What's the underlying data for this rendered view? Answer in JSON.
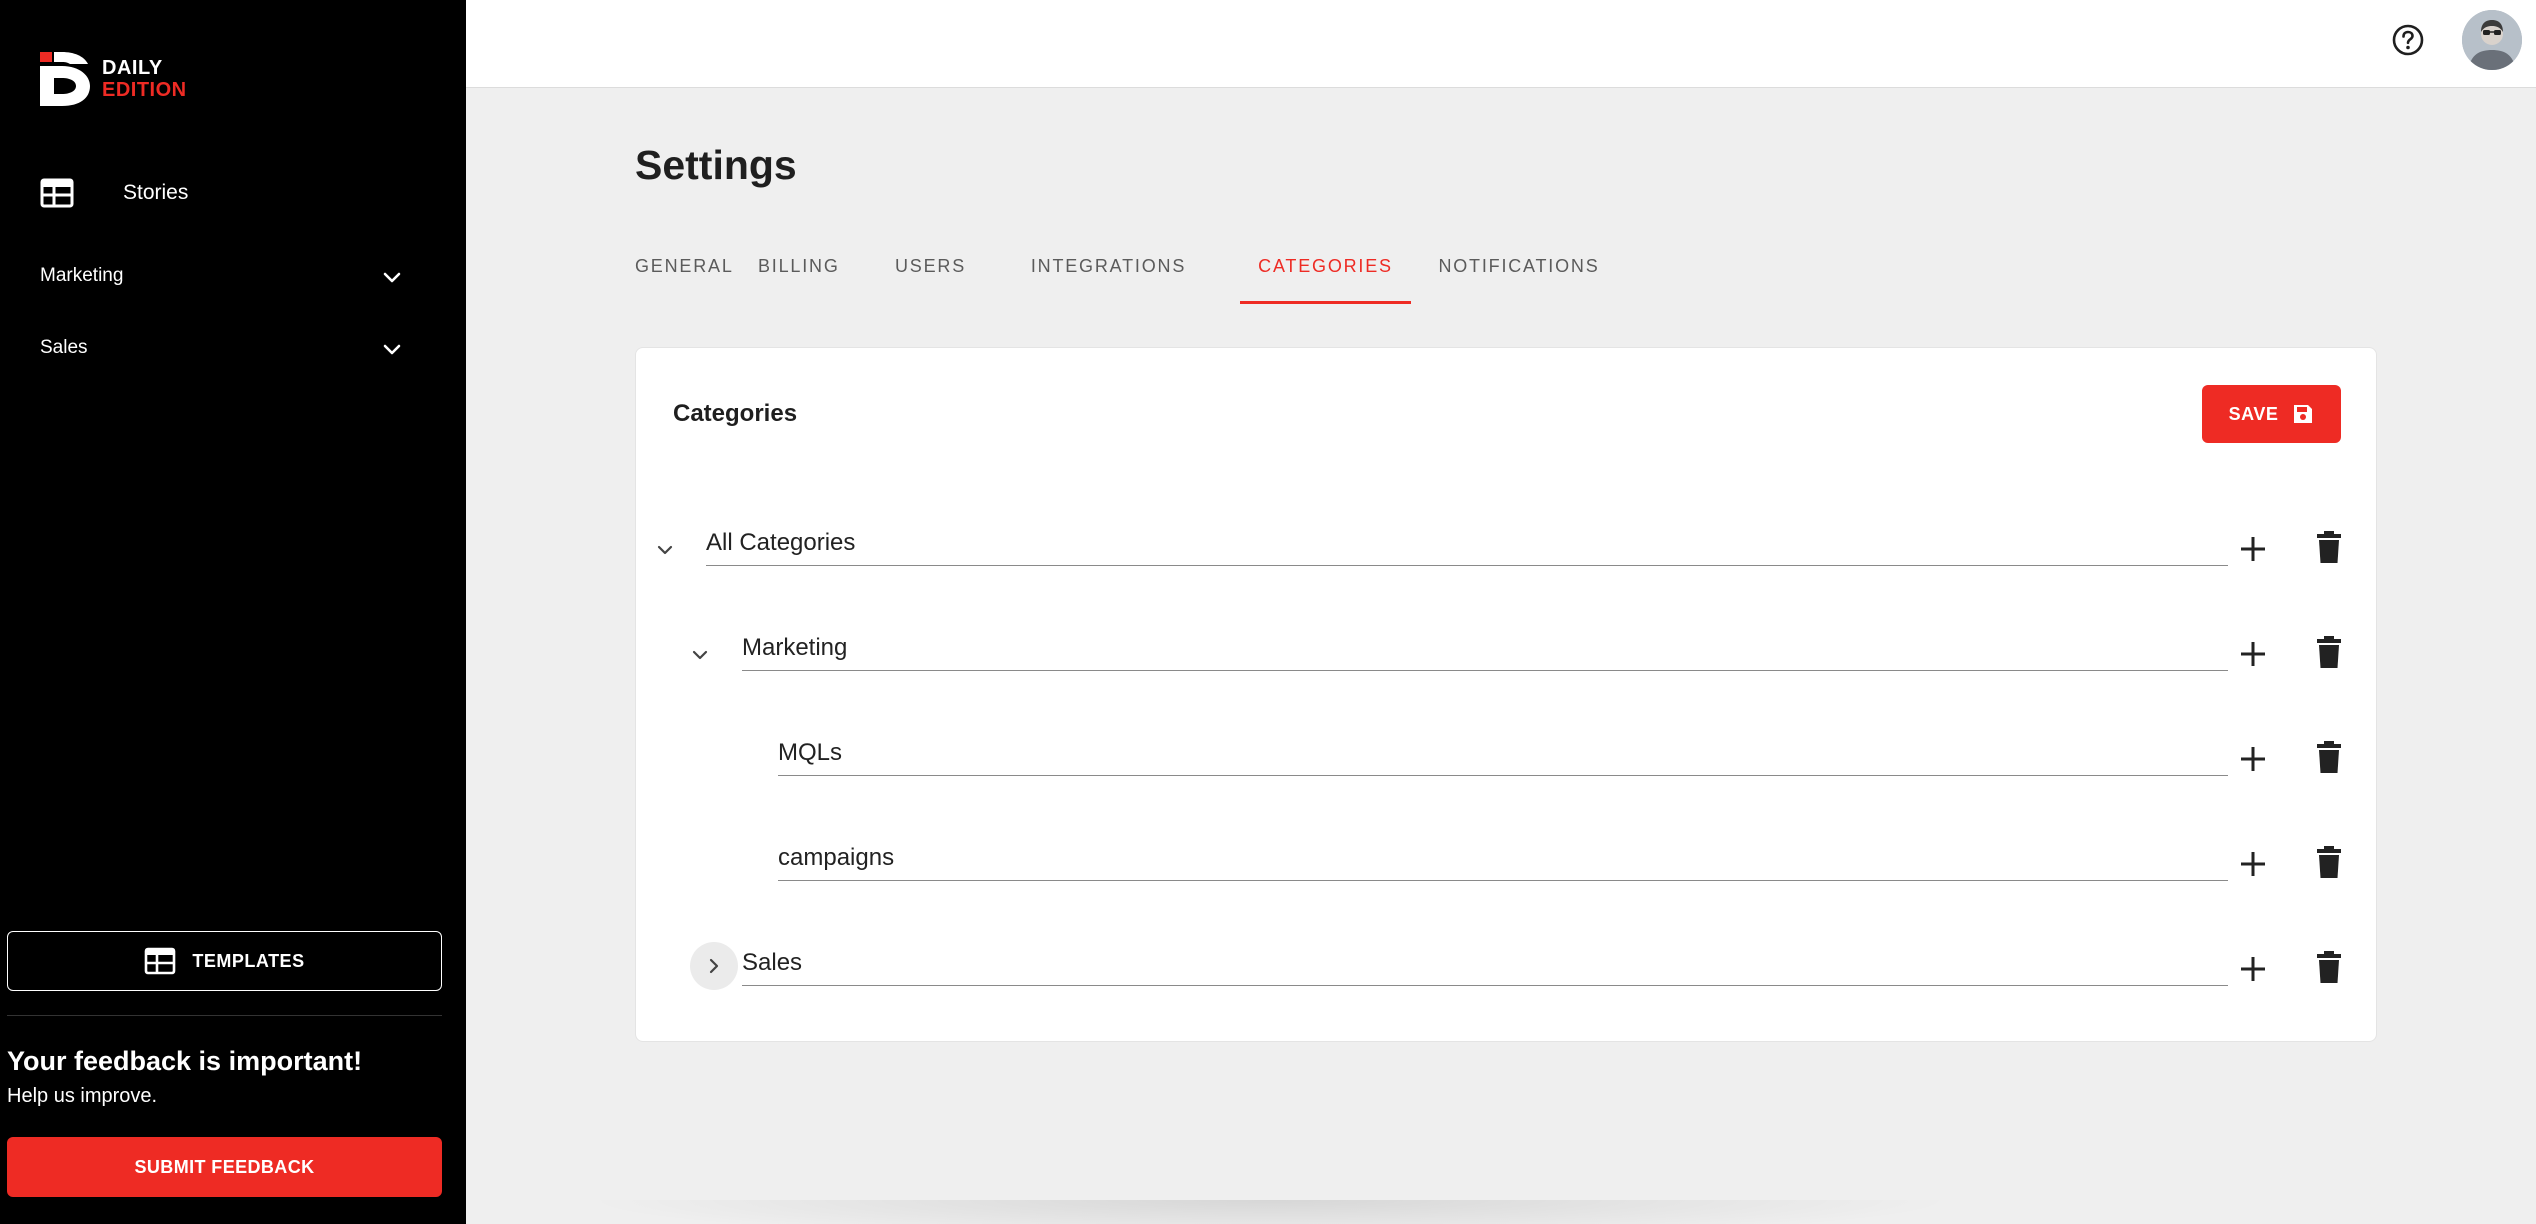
{
  "brand": {
    "line1": "DAILY",
    "line2": "EDITION",
    "accent": "#ee2b24"
  },
  "sidebar": {
    "stories_label": "Stories",
    "groups": [
      {
        "label": "Marketing"
      },
      {
        "label": "Sales"
      }
    ],
    "templates_label": "TEMPLATES",
    "feedback_title": "Your feedback is important!",
    "feedback_sub": "Help us improve.",
    "feedback_button": "SUBMIT FEEDBACK"
  },
  "topbar": {
    "help_icon": "help-circle-icon",
    "avatar": "user-avatar"
  },
  "page": {
    "title": "Settings"
  },
  "tabs": [
    {
      "label": "GENERAL",
      "active": false
    },
    {
      "label": "BILLING",
      "active": false
    },
    {
      "label": "USERS",
      "active": false
    },
    {
      "label": "INTEGRATIONS",
      "active": false
    },
    {
      "label": "CATEGORIES",
      "active": true
    },
    {
      "label": "NOTIFICATIONS",
      "active": false
    }
  ],
  "card": {
    "title": "Categories",
    "save_label": "SAVE",
    "categories": [
      {
        "value": "All Categories",
        "level": 0,
        "toggle": "expanded"
      },
      {
        "value": "Marketing",
        "level": 1,
        "toggle": "expanded"
      },
      {
        "value": "MQLs",
        "level": 2,
        "toggle": "none"
      },
      {
        "value": "campaigns",
        "level": 2,
        "toggle": "none"
      },
      {
        "value": "Sales",
        "level": 1,
        "toggle": "collapsed"
      }
    ]
  }
}
